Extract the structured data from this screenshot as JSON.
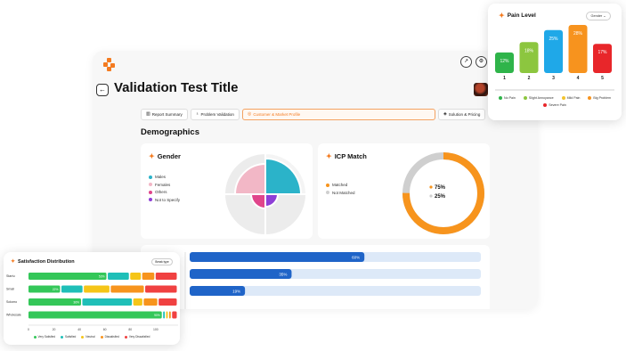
{
  "page": {
    "title": "Validation Test Title",
    "section_title": "Demographics"
  },
  "tabs": [
    {
      "label": "Report Summary",
      "icon": "bar-chart-icon"
    },
    {
      "label": "Problem Validation",
      "icon": "lightbulb-icon"
    },
    {
      "label": "Customer & Market Profile",
      "icon": "target-icon",
      "active": true
    },
    {
      "label": "Solution & Pricing",
      "icon": "price-tag-icon"
    }
  ],
  "gender": {
    "title": "Gender",
    "legend": [
      {
        "label": "Males",
        "color": "#2bb3c9"
      },
      {
        "label": "Females",
        "color": "#f2b7c6"
      },
      {
        "label": "Others",
        "color": "#e0458b"
      },
      {
        "label": "Not to Specify",
        "color": "#8e3fd6"
      }
    ]
  },
  "icp": {
    "title": "ICP Match",
    "legend": [
      {
        "label": "Matched",
        "color": "#f7941d"
      },
      {
        "label": "Not Matched",
        "color": "#cfcfcf"
      }
    ],
    "values": [
      {
        "label": "75%",
        "color": "#f7941d"
      },
      {
        "label": "25%",
        "color": "#cfcfcf"
      }
    ],
    "matched_fraction": 0.75
  },
  "main_bars": {
    "values": [
      {
        "label": "60%",
        "value": 60
      },
      {
        "label": "35%",
        "value": 35
      },
      {
        "label": "19%",
        "value": 19
      }
    ],
    "color": "#1f64c8",
    "track_color": "#dde9f8"
  },
  "pain_level": {
    "title": "Pain Level",
    "select_value": "Gender",
    "chart_data": {
      "type": "bar",
      "categories": [
        "1",
        "2",
        "3",
        "4",
        "5"
      ],
      "values": [
        12,
        18,
        25,
        28,
        17
      ],
      "value_labels": [
        "12%",
        "18%",
        "25%",
        "28%",
        "17%"
      ],
      "colors": [
        "#2fb44a",
        "#8cc63f",
        "#1fa8e8",
        "#f7931e",
        "#e8262a"
      ]
    },
    "legend": [
      {
        "label": "No Pain",
        "color": "#2fb44a"
      },
      {
        "label": "Slight Annoyance",
        "color": "#8cc63f"
      },
      {
        "label": "Mild Pain",
        "color": "#f2c32e"
      },
      {
        "label": "Big Problem",
        "color": "#f7931e"
      },
      {
        "label": "Severe Pain",
        "color": "#e8262a"
      }
    ]
  },
  "satisfaction": {
    "title": "Satisfaction Distribution",
    "button_label": "Break type",
    "chart_data": {
      "type": "bar",
      "orientation": "horizontal-stacked",
      "categories": [
        "Startu",
        "Small",
        "Solomo",
        "Wholesale"
      ],
      "x_ticks": [
        "0",
        "20",
        "40",
        "60",
        "80",
        "100"
      ],
      "series": [
        {
          "name": "Very Satisfied",
          "color": "#34c759",
          "values": [
            53,
            22,
            36,
            90
          ],
          "labels": [
            "53%",
            "22%",
            "36%",
            "90%"
          ]
        },
        {
          "name": "Satisfied",
          "color": "#1fbfb8",
          "values": [
            15,
            15,
            34,
            2
          ],
          "labels": [
            "",
            "",
            "",
            ""
          ]
        },
        {
          "name": "Neutral",
          "color": "#f5c518",
          "values": [
            8,
            18,
            7,
            2
          ],
          "labels": [
            "",
            "",
            "",
            ""
          ]
        },
        {
          "name": "Dissatisfied",
          "color": "#f7941d",
          "values": [
            9,
            23,
            10,
            2
          ],
          "labels": [
            "",
            "",
            "",
            ""
          ]
        },
        {
          "name": "Very Dissatisfied",
          "color": "#f04141",
          "values": [
            15,
            22,
            13,
            4
          ],
          "labels": [
            "",
            "",
            "",
            ""
          ]
        }
      ]
    }
  },
  "toolbar": {
    "icon_one": "↗",
    "icon_two": "⚙"
  }
}
